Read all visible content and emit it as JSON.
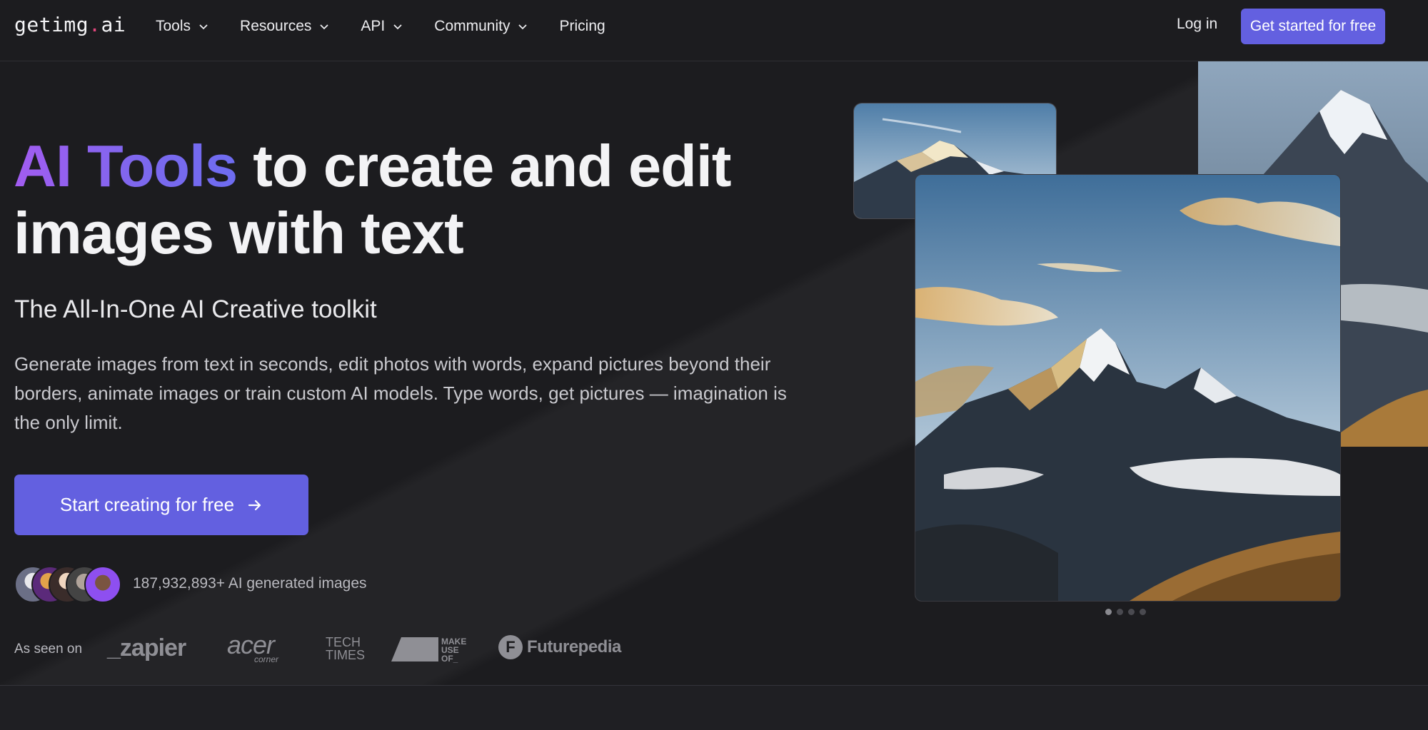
{
  "nav": {
    "logo": "getimg.ai",
    "logo_parts": [
      "getimg",
      ".",
      "ai"
    ],
    "items": [
      {
        "label": "Tools",
        "has_dropdown": true
      },
      {
        "label": "Resources",
        "has_dropdown": true
      },
      {
        "label": "API",
        "has_dropdown": true
      },
      {
        "label": "Community",
        "has_dropdown": true
      },
      {
        "label": "Pricing",
        "has_dropdown": false
      }
    ],
    "login_label": "Log in",
    "cta_label": "Get started for free"
  },
  "hero": {
    "title_highlight": "AI Tools",
    "title_rest_line1": " to create and edit",
    "title_line2": "images with text",
    "subtitle": "The All-In-One AI Creative toolkit",
    "description": "Generate images from text in seconds, edit photos with words, expand pictures beyond their borders, animate images or train custom AI models. Type words, get pictures — imagination is the only limit.",
    "cta_label": "Start creating for free",
    "generated_count_text": "187,932,893+ AI generated images",
    "as_seen_on_label": "As seen on",
    "press_logos": [
      "_zapier",
      "acer",
      "corner",
      "TECH",
      "TIMES",
      "MAKE",
      "USE",
      "OF_",
      "Futurepedia"
    ]
  },
  "carousel": {
    "slides": 4,
    "active_index": 0
  },
  "colors": {
    "background": "#1c1c1f",
    "accent": "#6360e0",
    "gradient_start": "#a25cf0",
    "gradient_end": "#6e6cf0",
    "muted_text": "#b9b9bf"
  }
}
